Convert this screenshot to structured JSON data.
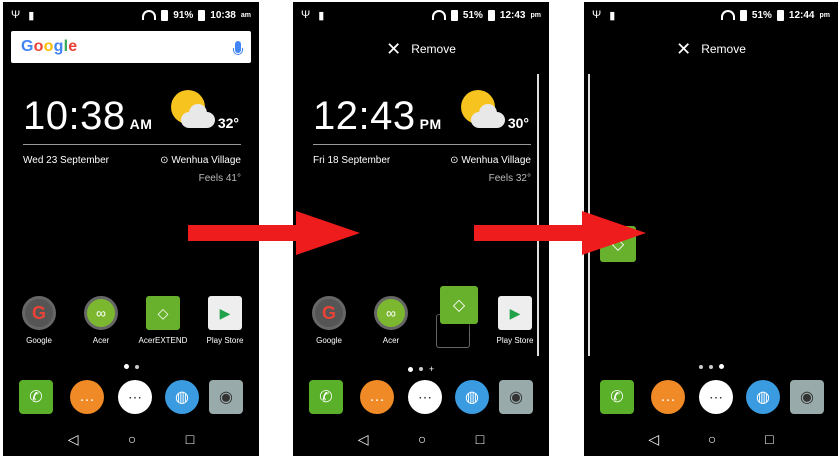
{
  "screen1": {
    "status": {
      "battery": "91%",
      "time": "10:38",
      "ampm": "am"
    },
    "search": {
      "logo": "Google"
    },
    "clock": {
      "time": "10:38",
      "ampm": "AM"
    },
    "weather": {
      "temp": "32°"
    },
    "date": "Wed 23 September",
    "location": "Wenhua Village",
    "feels": "Feels 41°",
    "apps": [
      {
        "label": "Google",
        "icon": "google-icon"
      },
      {
        "label": "Acer",
        "icon": "acer-icon"
      },
      {
        "label": "AcerEXTEND",
        "icon": "acerextend-icon"
      },
      {
        "label": "Play Store",
        "icon": "play-store-icon"
      }
    ]
  },
  "screen2": {
    "status": {
      "battery": "51%",
      "time": "12:43",
      "ampm": "pm"
    },
    "remove": "Remove",
    "clock": {
      "time": "12:43",
      "ampm": "PM"
    },
    "weather": {
      "temp": "30°"
    },
    "date": "Fri 18 September",
    "location": "Wenhua Village",
    "feels": "Feels 32°",
    "apps": [
      {
        "label": "Google",
        "icon": "google-icon"
      },
      {
        "label": "Acer",
        "icon": "acer-icon"
      },
      {
        "label": "Play Store",
        "icon": "play-store-icon"
      }
    ],
    "page_plus": "+"
  },
  "screen3": {
    "status": {
      "battery": "51%",
      "time": "12:44",
      "ampm": "pm"
    },
    "remove": "Remove"
  },
  "dock": [
    "phone-icon",
    "messages-icon",
    "app-drawer-icon",
    "browser-icon",
    "camera-icon"
  ],
  "colors": {
    "arrow": "#ee1c1c",
    "accent_green": "#68b12c"
  }
}
